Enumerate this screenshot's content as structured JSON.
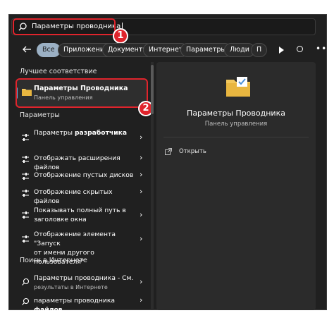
{
  "search": {
    "value": "Параметры проводника"
  },
  "filters": {
    "chips": [
      "Все",
      "Приложения",
      "Документы",
      "Интернет",
      "Параметры",
      "Люди",
      "П"
    ],
    "more": "•••"
  },
  "best_match": {
    "header": "Лучшее соответствие",
    "title": "Параметры Проводника",
    "subtitle": "Панель управления"
  },
  "settings": {
    "header": "Параметры",
    "items": [
      {
        "pre": "Параметры ",
        "bold": "разработчика",
        "line2": "",
        "bold2": "",
        "pre2": ""
      },
      {
        "pre": "Отображать расширения файлов",
        "bold": "",
        "line2": ""
      },
      {
        "pre": "Отображение пустых дисков",
        "bold": "",
        "line2": ""
      },
      {
        "pre": "Отображение скрытых файлов",
        "bold": "",
        "line2": ""
      },
      {
        "pre": "Показывать полный путь в",
        "bold": "",
        "line2": "заголовке окна"
      },
      {
        "pre": "Отображение элемента \"Запуск",
        "bold": "",
        "line2": "от имени другого пользователя\""
      }
    ]
  },
  "web": {
    "header": "Поиск в Интернете",
    "items": [
      {
        "line1": "Параметры проводника - См.",
        "line2": "результаты в Интернете"
      },
      {
        "pre": "параметры проводника ",
        "bold": "файлов"
      }
    ]
  },
  "preview": {
    "title": "Параметры Проводника",
    "subtitle": "Панель управления",
    "action": "Открыть"
  },
  "badges": {
    "one": "1",
    "two": "2"
  },
  "colors": {
    "highlight": "#e0242c",
    "accent": "#6aa8d8",
    "folder": "#f2c75c"
  }
}
